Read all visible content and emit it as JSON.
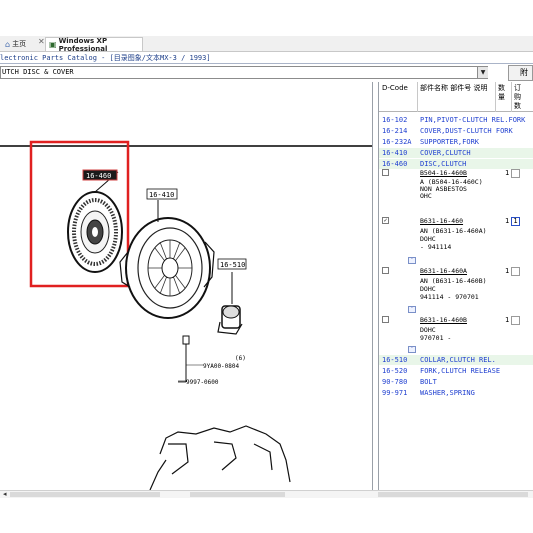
{
  "browser": {
    "tabs": [
      {
        "label": "主页",
        "icon": "home-icon"
      },
      {
        "label": "Windows XP Professional",
        "icon": "vm-icon",
        "active": true
      }
    ]
  },
  "app": {
    "title": "lectronic Parts Catalog - [目录图象/文本MX-3 / 1993]",
    "current_group": "UTCH DISC & COVER",
    "attach_label": "附"
  },
  "diagram": {
    "callouts": [
      "16-460",
      "16-410",
      "16-510",
      "9YA00-0804",
      "(6)",
      "9997-0600"
    ]
  },
  "grid": {
    "headers": {
      "code": "D-Code",
      "name": "部件名称 部件号 说明",
      "qty": "数量",
      "order": "订购数"
    },
    "rows_top": [
      {
        "code": "16-102",
        "desc": "PIN,PIVOT-CLUTCH REL.FORK"
      },
      {
        "code": "16-214",
        "desc": "COVER,DUST-CLUTCH FORK"
      },
      {
        "code": "16-232A",
        "desc": "SUPPORTER,FORK"
      },
      {
        "code": "16-410",
        "desc": "COVER,CLUTCH"
      },
      {
        "code": "16-460",
        "desc": "DISC,CLUTCH"
      }
    ],
    "subparts": [
      {
        "part": "B504-16-460B",
        "lines": [
          "A (B504-16-460C)",
          "NON ASBESTOS",
          "OHC"
        ],
        "qty": "1",
        "order": "",
        "checked": false
      },
      {
        "part": "B631-16-460",
        "lines": [
          "AN (B631-16-460A)",
          "DOHC",
          "        - 941114"
        ],
        "qty": "1",
        "order": "1",
        "checked": true
      },
      {
        "part": "B631-16-460A",
        "lines": [
          "AN (B631-16-460B)",
          "DOHC",
          "941114    - 970701"
        ],
        "qty": "1",
        "order": "",
        "checked": false
      },
      {
        "part": "B631-16-460B",
        "lines": [
          "DOHC",
          "970701    -"
        ],
        "qty": "1",
        "order": "",
        "checked": false
      }
    ],
    "rows_bottom": [
      {
        "code": "16-510",
        "desc": "COLLAR,CLUTCH REL."
      },
      {
        "code": "16-520",
        "desc": "FORK,CLUTCH RELEASE"
      },
      {
        "code": "90-780",
        "desc": "BOLT"
      },
      {
        "code": "99-971",
        "desc": "WASHER,SPRING"
      }
    ]
  }
}
